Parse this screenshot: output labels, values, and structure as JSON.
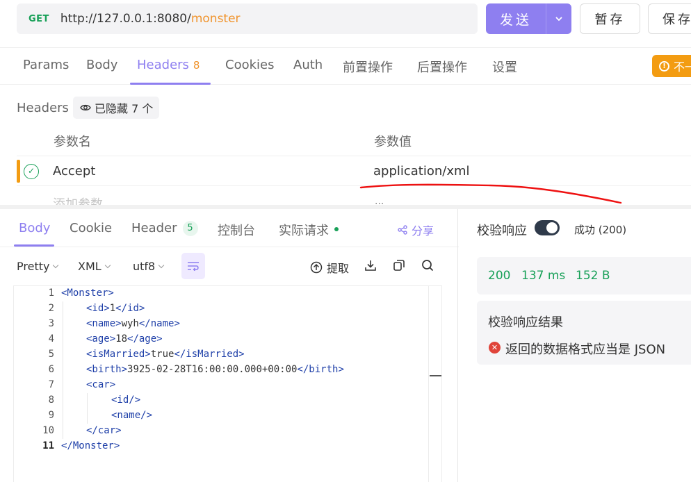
{
  "request": {
    "method": "GET",
    "url_base": "http://127.0.0.1:8080/",
    "url_path": "monster",
    "send_label": "发送",
    "save_temp_label": "暂存",
    "save_label": "保存"
  },
  "request_tabs": [
    {
      "label": "Params"
    },
    {
      "label": "Body"
    },
    {
      "label": "Headers",
      "count": "8"
    },
    {
      "label": "Cookies"
    },
    {
      "label": "Auth"
    },
    {
      "label": "前置操作"
    },
    {
      "label": "后置操作"
    },
    {
      "label": "设置"
    }
  ],
  "warning_pill": {
    "label": "不一"
  },
  "headers": {
    "title": "Headers",
    "hidden_chip": "已隐藏 7 个",
    "col_name": "参数名",
    "col_value": "参数值",
    "rows": [
      {
        "name": "Accept",
        "value": "application/xml"
      }
    ],
    "add_placeholder": "添加参数",
    "ellipsis": "..."
  },
  "response_tabs": [
    {
      "label": "Body"
    },
    {
      "label": "Cookie"
    },
    {
      "label": "Header",
      "badge": "5"
    },
    {
      "label": "控制台"
    },
    {
      "label": "实际请求"
    }
  ],
  "share_label": "分享",
  "body_toolbar": {
    "format": "Pretty",
    "type": "XML",
    "encoding": "utf8",
    "extract_label": "提取"
  },
  "code": {
    "line_numbers": [
      "1",
      "2",
      "3",
      "4",
      "5",
      "6",
      "7",
      "8",
      "9",
      "10",
      "11"
    ],
    "lines": [
      [
        "<Monster>",
        "",
        ""
      ],
      [
        "<id>",
        "1",
        "</id>"
      ],
      [
        "<name>",
        "wyh",
        "</name>"
      ],
      [
        "<age>",
        "18",
        "</age>"
      ],
      [
        "<isMarried>",
        "true",
        "</isMarried>"
      ],
      [
        "<birth>",
        "3925-02-28T16:00:00.000+00:00",
        "</birth>"
      ],
      [
        "<car>",
        "",
        ""
      ],
      [
        "<id/>",
        "",
        ""
      ],
      [
        "<name/>",
        "",
        ""
      ],
      [
        "</car>",
        "",
        ""
      ],
      [
        "</Monster>",
        "",
        ""
      ]
    ]
  },
  "validation": {
    "label": "校验响应",
    "status": "成功 (200)",
    "enabled": true
  },
  "stats": {
    "code": "200",
    "time": "137 ms",
    "size": "152 B"
  },
  "result": {
    "title": "校验响应结果",
    "error": "返回的数据格式应当是 JSON"
  },
  "colors": {
    "accent": "#8e7ff0",
    "success": "#18a058",
    "warning": "#f39c12",
    "error": "#e0443a",
    "xml_tag": "#1e3fa8"
  }
}
